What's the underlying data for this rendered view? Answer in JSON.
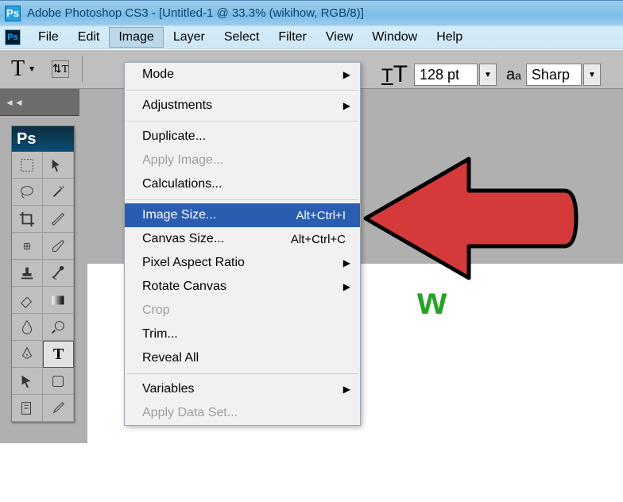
{
  "titlebar": {
    "logo_text": "Ps",
    "title": "Adobe Photoshop CS3 - [Untitled-1 @ 33.3% (wikihow, RGB/8)]"
  },
  "menubar": {
    "logo_text": "Ps",
    "items": [
      "File",
      "Edit",
      "Image",
      "Layer",
      "Select",
      "Filter",
      "View",
      "Window",
      "Help"
    ],
    "open_index": 2
  },
  "optbar": {
    "tool_letter": "T",
    "font_size_value": "128 pt",
    "aa_label": "a",
    "aa_sub": "a",
    "aa_value": "Sharp"
  },
  "toolbox": {
    "header": "Ps"
  },
  "image_menu": {
    "groups": [
      [
        {
          "label": "Mode",
          "arrow": true
        }
      ],
      [
        {
          "label": "Adjustments",
          "arrow": true
        }
      ],
      [
        {
          "label": "Duplicate..."
        },
        {
          "label": "Apply Image...",
          "disabled": true
        },
        {
          "label": "Calculations..."
        }
      ],
      [
        {
          "label": "Image Size...",
          "shortcut": "Alt+Ctrl+I",
          "highlight": true
        },
        {
          "label": "Canvas Size...",
          "shortcut": "Alt+Ctrl+C"
        },
        {
          "label": "Pixel Aspect Ratio",
          "arrow": true
        },
        {
          "label": "Rotate Canvas",
          "arrow": true
        },
        {
          "label": "Crop",
          "disabled": true
        },
        {
          "label": "Trim..."
        },
        {
          "label": "Reveal All"
        }
      ],
      [
        {
          "label": "Variables",
          "arrow": true
        },
        {
          "label": "Apply Data Set...",
          "disabled": true
        }
      ]
    ]
  },
  "canvas": {
    "visible_text": "w"
  },
  "annotation": {
    "color": "#d43a3a"
  }
}
